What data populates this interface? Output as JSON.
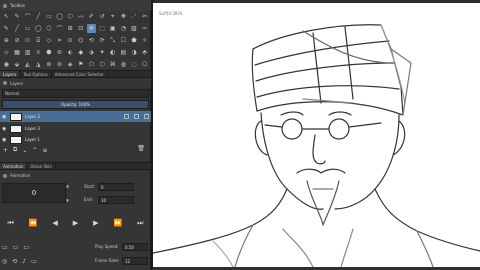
{
  "toolbox": {
    "title": "Toolbox",
    "rows": [
      [
        "↖",
        "✎",
        "⌒",
        "╱",
        "▭",
        "◯",
        "⬡",
        "〰",
        "✐",
        "↺",
        "⌖",
        "✥",
        "⤢",
        "✂"
      ],
      [
        "✎",
        "╱",
        "▭",
        "◯",
        "⬡",
        "⌒",
        "⊞",
        "⊡",
        "✥",
        "⬚",
        "▣",
        "◔",
        "▨",
        "✑"
      ],
      [
        "⊕",
        "⊘",
        "⬭",
        "⌸",
        "◇",
        "⌗",
        "⊙",
        "⌬",
        "⟲",
        "⟳",
        "⤡",
        "☐",
        "⬟",
        "✧"
      ],
      [
        "⊹",
        "▦",
        "▥",
        "⌾",
        "⬢",
        "⊚",
        "⬖",
        "◆",
        "⬗",
        "✦",
        "◐",
        "▤",
        "◑",
        "⬘"
      ],
      [
        "◉",
        "⬙",
        "◭",
        "◮",
        "⊛",
        "⊜",
        "◈",
        "⚑",
        "⬠",
        "⬡",
        "⌘",
        "◍",
        "◌",
        "⎔"
      ]
    ]
  },
  "tabs_top": [
    "Layers",
    "Tool Options",
    "Advanced Color Selector"
  ],
  "layers": {
    "title": "Layers",
    "blend_mode": "Normal",
    "opacity": "Opacity: 100%",
    "items": [
      {
        "name": "Layer 2",
        "selected": true
      },
      {
        "name": "Layer 3",
        "selected": false
      },
      {
        "name": "Layer 1",
        "selected": false
      }
    ]
  },
  "tabs_bottom": [
    "Animation",
    "Onion Skin"
  ],
  "animation": {
    "title": "Animation",
    "current_frame": "0",
    "start_label": "Start:",
    "start_value": "0",
    "end_label": "End:",
    "end_value": "10",
    "play_speed_label": "Play Speed:",
    "play_speed_value": "0.50",
    "frame_rate_label": "Frame Rate:",
    "frame_rate_value": "12"
  },
  "canvas": {
    "label": "Suff(4:38)%"
  }
}
